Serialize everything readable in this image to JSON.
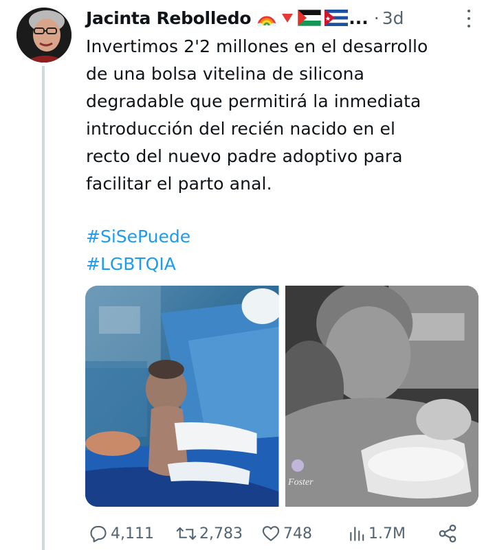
{
  "tweet": {
    "author": "Jacinta Rebolledo",
    "ellipsis": "...",
    "separator": "·",
    "time": "3d",
    "text_lines": [
      "Invertimos 2'2 millones en el desarrollo",
      "de una bolsa vitelina de silicona",
      "degradable que permitirá la inmediata",
      "introducción del recién nacido en el",
      "recto del nuevo padre adoptivo para",
      "facilitar el parto anal."
    ],
    "hashtags": [
      "#SiSePuede",
      "#LGBTQIA"
    ],
    "flag_emojis": [
      "rainbow-emoji",
      "red-triangle-emoji",
      "palestine-flag-emoji",
      "cuba-flag-emoji"
    ]
  },
  "media": {
    "left_image": "newborn-baby-in-operating-room-photo",
    "right_image": "men-holding-newborn-bw-photo",
    "watermark": "Foster"
  },
  "actions": {
    "replies": "4,111",
    "retweets": "2,783",
    "likes": "748",
    "views": "1.7M"
  },
  "colors": {
    "text": "#0f1419",
    "secondary": "#536471",
    "link": "#1d9bf0",
    "thread_line": "#cfd9de"
  }
}
